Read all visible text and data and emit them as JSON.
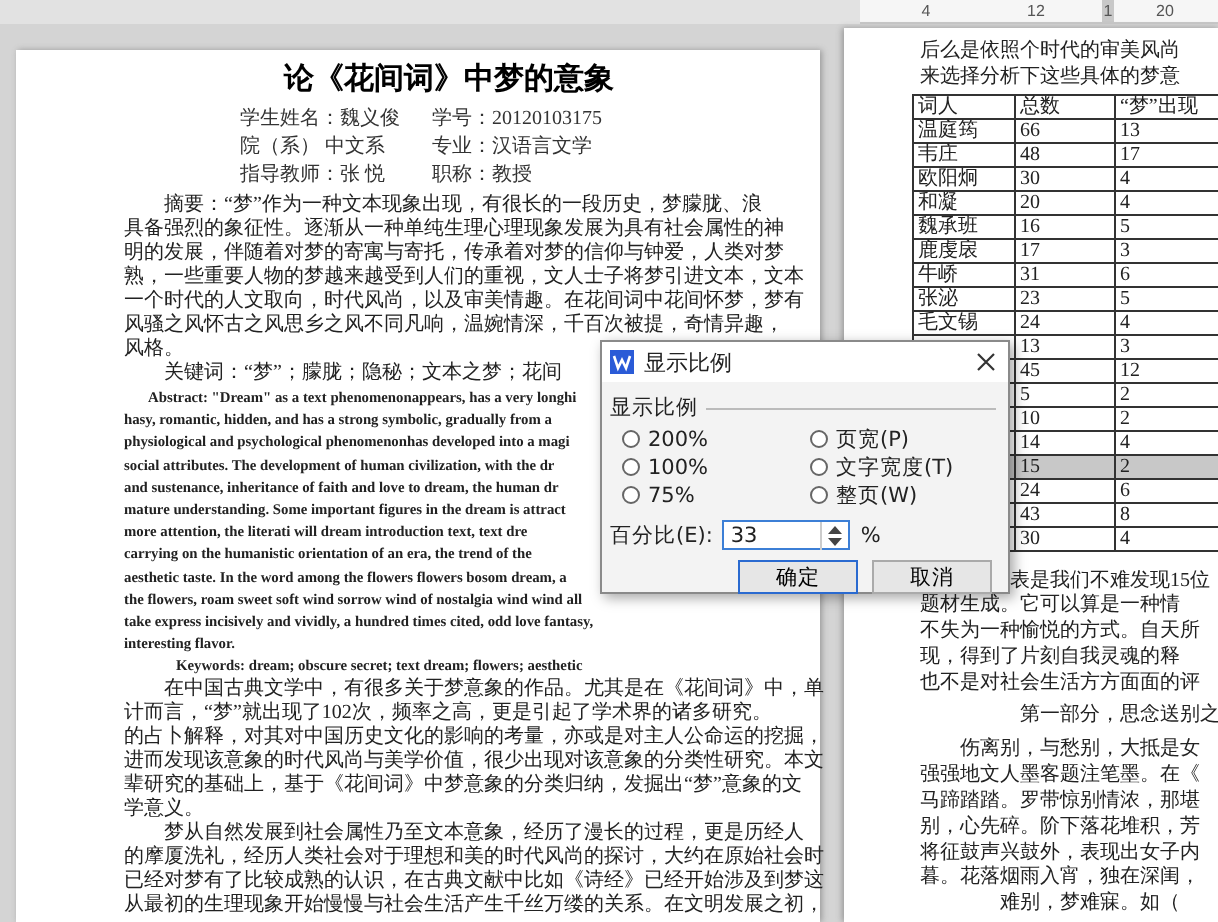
{
  "left_page": {
    "title": "论《花间词》中梦的意象",
    "info": [
      {
        "left": "学生姓名：魏义俊",
        "right": "学号：20120103175"
      },
      {
        "left": "院（系） 中文系",
        "right": "专业：汉语言文学"
      },
      {
        "left": "指导教师：张 悦",
        "right": "职称：教授"
      }
    ],
    "abstract_cn": [
      "摘要：“梦”作为一种文本现象出现，有很长的一段历史，梦朦胧、浪",
      "具备强烈的象征性。逐渐从一种单纯生理心理现象发展为具有社会属性的神",
      "明的发展，伴随着对梦的寄寓与寄托，传承着对梦的信仰与钟爱，人类对梦",
      "熟，一些重要人物的梦越来越受到人们的重视，文人士子将梦引进文本，文本",
      "一个时代的人文取向，时代风尚，以及审美情趣。在花间词中花间怀梦，梦有",
      "风骚之风怀古之风思乡之风不同凡响，温婉情深，千百次被提，奇情异趣，",
      "风格。"
    ],
    "keywords_cn": "关键词：“梦”；朦胧；隐秘；文本之梦；花间",
    "abstract_en": [
      "Abstract: \"Dream\" as a text phenomenonappears, has a very longhi",
      "hasy, romantic, hidden, and has a strong symbolic, gradually from a",
      "physiological and psychological phenomenonhas developed into a magi",
      "social attributes. The development of human civilization, with the dr",
      "and sustenance, inheritance of faith and love to dream, the human dr",
      "mature understanding. Some important figures in the dream is attract",
      "more attention, the literati will dream introduction text, text dre",
      "carrying on the humanistic orientation of an era, the trend of the",
      "aesthetic taste. In the word among the flowers flowers bosom dream, a",
      "the flowers, roam sweet soft wind sorrow wind of nostalgia wind wind all",
      "take express incisively and vividly, a hundred times cited, odd love fantasy,",
      "interesting flavor."
    ],
    "keywords_en": "Keywords: dream; obscure secret; text dream; flowers; aesthetic",
    "body": [
      [
        "在中国古典文学中，有很多关于梦意象的作品。尤其是在《花间词》中，单",
        "计而言，“梦”就出现了102次，频率之高，更是引起了学术界的诸多研究。",
        "的占卜解释，对其对中国历史文化的影响的考量，亦或是对主人公命运的挖掘，",
        "进而发现该意象的时代风尚与美学价值，很少出现对该意象的分类性研究。本文",
        "辈研究的基础上，基于《花间词》中梦意象的分类归纳，发掘出“梦”意象的文",
        "学意义。"
      ],
      [
        "梦从自然发展到社会属性乃至文本意象，经历了漫长的过程，更是历经人",
        "的摩厦洗礼，经历人类社会对于理想和美的时代风尚的探讨，大约在原始社会时",
        "已经对梦有了比较成熟的认识，在古典文献中比如《诗经》已经开始涉及到梦这",
        "从最初的生理现象开始慢慢与社会生活产生千丝万缕的关系。在文明发展之初，"
      ]
    ]
  },
  "right_page": {
    "ruler": [
      "4",
      "12",
      "1",
      "20"
    ],
    "intro": [
      "后么是依照个时代的审美风尚",
      "来选择分析下这些具体的梦意"
    ],
    "table": {
      "columns": [
        "词人",
        "总数",
        "“梦”出现"
      ],
      "rows": [
        {
          "name": "温庭筠",
          "total": "66",
          "dream": "13",
          "shaded": false
        },
        {
          "name": "韦庄",
          "total": "48",
          "dream": "17",
          "shaded": false
        },
        {
          "name": "欧阳炯",
          "total": "30",
          "dream": "4",
          "shaded": false
        },
        {
          "name": "和凝",
          "total": "20",
          "dream": "4",
          "shaded": false
        },
        {
          "name": "魏承班",
          "total": "16",
          "dream": "5",
          "shaded": false
        },
        {
          "name": "鹿虔扆",
          "total": "17",
          "dream": "3",
          "shaded": false
        },
        {
          "name": "牛峤",
          "total": "31",
          "dream": "6",
          "shaded": false
        },
        {
          "name": "张泌",
          "total": "23",
          "dream": "5",
          "shaded": false
        },
        {
          "name": "毛文锡",
          "total": "24",
          "dream": "4",
          "shaded": false
        },
        {
          "total": "13",
          "dream": "3",
          "shaded": false
        },
        {
          "total": "45",
          "dream": "12",
          "shaded": false
        },
        {
          "total": "5",
          "dream": "2",
          "shaded": false
        },
        {
          "total": "10",
          "dream": "2",
          "shaded": false
        },
        {
          "total": "14",
          "dream": "4",
          "shaded": false
        },
        {
          "total": "15",
          "dream": "2",
          "shaded": true
        },
        {
          "total": "24",
          "dream": "6",
          "shaded": false
        },
        {
          "total": "43",
          "dream": "8",
          "shaded": false
        },
        {
          "total": "30",
          "dream": "4",
          "shaded": false
        }
      ]
    },
    "paragraph": [
      "表是我们不难发现15位",
      "题材生成。它可以算是一种情",
      "不失为一种愉悦的方式。自天所",
      "现，得到了片刻自我灵魂的释",
      "也不是对社会生活方方面面的评"
    ],
    "heading": "第一部分，思念送别之",
    "section": [
      "伤离别，与愁别，大抵是女",
      "强强地文人墨客题注笔墨。在《",
      "马蹄踏踏。罗带惊别情浓，那堪",
      "别，心先碎。阶下落花堆积，芳",
      "将征鼓声兴鼓外，表现出女子内",
      "暮。花落烟雨入宵，独在深闺，"
    ],
    "closing": "难别，梦难寐。如（"
  },
  "dialog": {
    "title": "显示比例",
    "group": "显示比例",
    "options": [
      {
        "label": "200%",
        "selected": false
      },
      {
        "label": "页宽(P)",
        "selected": false
      },
      {
        "label": "100%",
        "selected": false
      },
      {
        "label": "文字宽度(T)",
        "selected": false
      },
      {
        "label": "75%",
        "selected": false
      },
      {
        "label": "整页(W)",
        "selected": false
      }
    ],
    "percent_label": "百分比(E):",
    "percent_value": "33",
    "percent_unit": "%",
    "buttons": [
      {
        "label": "确定",
        "focused": true
      },
      {
        "label": "取消",
        "focused": false
      }
    ]
  }
}
